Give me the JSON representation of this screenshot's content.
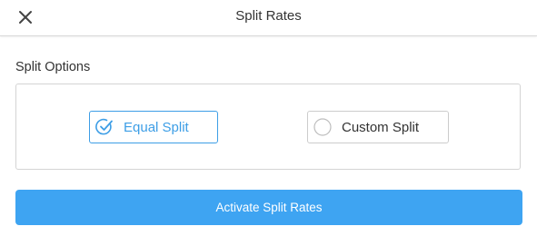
{
  "header": {
    "title": "Split Rates",
    "close_icon": "close-icon"
  },
  "split_options": {
    "label": "Split Options",
    "options": [
      {
        "label": "Equal Split",
        "selected": true,
        "icon": "check-circle-icon"
      },
      {
        "label": "Custom Split",
        "selected": false,
        "icon": "empty-circle-icon"
      }
    ]
  },
  "actions": {
    "activate_label": "Activate Split Rates"
  },
  "colors": {
    "accent": "#3d9ee6",
    "button": "#3ea4f2"
  }
}
